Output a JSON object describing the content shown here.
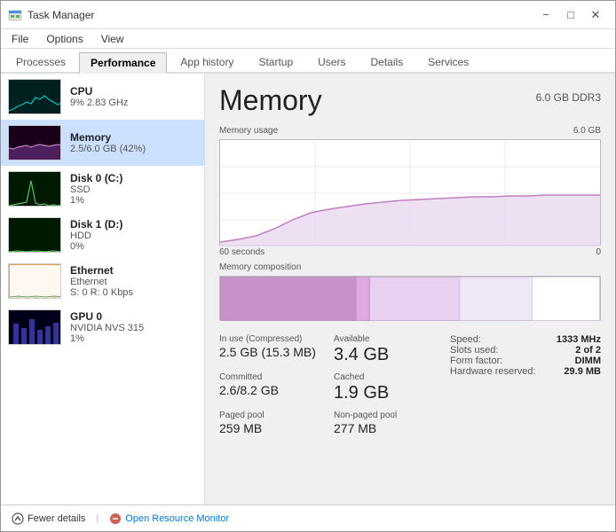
{
  "window": {
    "title": "Task Manager",
    "icon": "task-manager-icon"
  },
  "menu": {
    "items": [
      "File",
      "Options",
      "View"
    ]
  },
  "tabs": [
    {
      "label": "Processes",
      "active": false
    },
    {
      "label": "Performance",
      "active": true
    },
    {
      "label": "App history",
      "active": false
    },
    {
      "label": "Startup",
      "active": false
    },
    {
      "label": "Users",
      "active": false
    },
    {
      "label": "Details",
      "active": false
    },
    {
      "label": "Services",
      "active": false
    }
  ],
  "sidebar": {
    "items": [
      {
        "name": "CPU",
        "detail1": "9% 2.83 GHz",
        "detail2": "",
        "type": "cpu",
        "active": false
      },
      {
        "name": "Memory",
        "detail1": "2.5/6.0 GB (42%)",
        "detail2": "",
        "type": "memory",
        "active": true
      },
      {
        "name": "Disk 0 (C:)",
        "detail1": "SSD",
        "detail2": "1%",
        "type": "disk0",
        "active": false
      },
      {
        "name": "Disk 1 (D:)",
        "detail1": "HDD",
        "detail2": "0%",
        "type": "disk1",
        "active": false
      },
      {
        "name": "Ethernet",
        "detail1": "Ethernet",
        "detail2": "S: 0  R: 0 Kbps",
        "type": "ethernet",
        "active": false
      },
      {
        "name": "GPU 0",
        "detail1": "NVIDIA NVS 315",
        "detail2": "1%",
        "type": "gpu",
        "active": false
      }
    ]
  },
  "detail": {
    "title": "Memory",
    "spec": "6.0 GB DDR3",
    "chart_label": "Memory usage",
    "chart_max": "6.0 GB",
    "time_left": "60 seconds",
    "time_right": "0",
    "composition_label": "Memory composition",
    "stats": {
      "in_use_label": "In use (Compressed)",
      "in_use_value": "2.5 GB (15.3 MB)",
      "available_label": "Available",
      "available_value": "3.4 GB",
      "committed_label": "Committed",
      "committed_value": "2.6/8.2 GB",
      "cached_label": "Cached",
      "cached_value": "1.9 GB",
      "paged_pool_label": "Paged pool",
      "paged_pool_value": "259 MB",
      "non_paged_pool_label": "Non-paged pool",
      "non_paged_pool_value": "277 MB"
    },
    "right_stats": {
      "speed_label": "Speed:",
      "speed_value": "1333 MHz",
      "slots_label": "Slots used:",
      "slots_value": "2 of 2",
      "form_label": "Form factor:",
      "form_value": "DIMM",
      "reserved_label": "Hardware reserved:",
      "reserved_value": "29.9 MB"
    }
  },
  "footer": {
    "fewer_details_label": "Fewer details",
    "open_resource_monitor_label": "Open Resource Monitor"
  },
  "colors": {
    "accent_blue": "#0078d7",
    "memory_line": "#c080c0",
    "memory_fill": "#f0e8f8",
    "cpu_line": "#00b0b0",
    "disk_line": "#60c060",
    "gpu_line": "#6060e0",
    "chart_border": "#c0a0c0",
    "composition_in_use": "#c890c8",
    "composition_modified": "#e0b0e0",
    "composition_standby": "#e8d8f8",
    "composition_free": "#ffffff"
  }
}
